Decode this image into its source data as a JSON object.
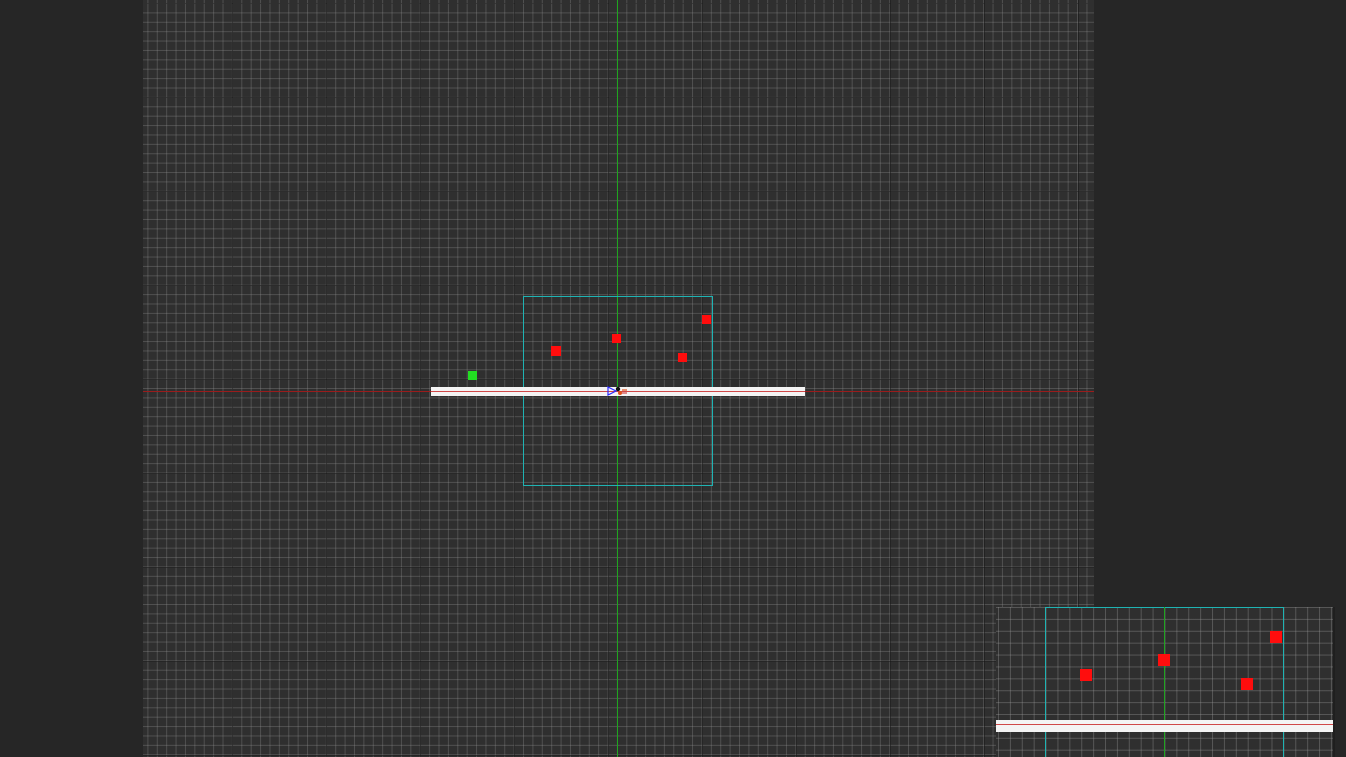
{
  "scene_view": {
    "grid": "on",
    "axis_colors": {
      "x_axis": "#9a1c1c",
      "y_axis": "#1fa51f"
    },
    "camera_bounds_color": "#1fb3b3",
    "platform_color": "#f4f4f4",
    "enemy_marker_color": "#ff0d0d",
    "spawn_marker_color": "#22dd22",
    "player_icon": "player-gizmo-icon"
  },
  "mini_view": {
    "grid": "on",
    "enemy_marker_color": "#ff0d0d"
  }
}
